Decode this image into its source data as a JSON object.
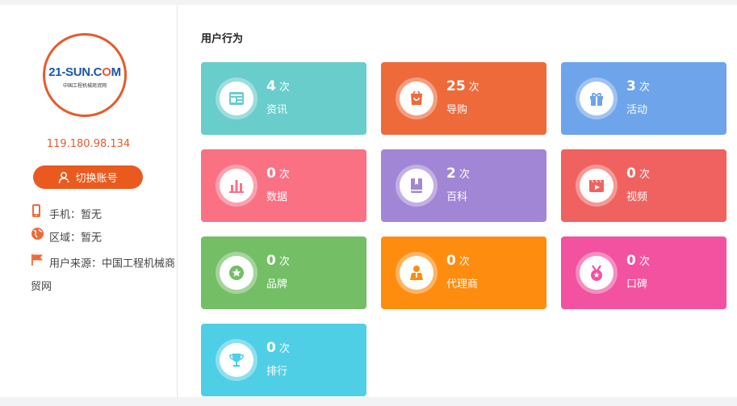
{
  "profile": {
    "logo_main_part1": "21-SUN.C",
    "logo_main_o": "O",
    "logo_main_part2": "M",
    "logo_sub": "中国工程机械商贸网",
    "ip": "119.180.98.134",
    "switch_label": "切换账号",
    "phone": "手机：暂无",
    "region": "区域：暂无",
    "source": "用户来源：中国工程机械商贸网"
  },
  "behavior": {
    "title": "用户行为",
    "unit": "次",
    "cards": [
      {
        "count": "4",
        "label": "资讯",
        "icon": "news-icon",
        "color": "#68cdcb"
      },
      {
        "count": "25",
        "label": "导购",
        "icon": "shopping-bag-icon",
        "color": "#ee6a3a"
      },
      {
        "count": "3",
        "label": "活动",
        "icon": "gift-icon",
        "color": "#6ea4ea"
      },
      {
        "count": "0",
        "label": "数据",
        "icon": "bar-chart-icon",
        "color": "#fb7184"
      },
      {
        "count": "2",
        "label": "百科",
        "icon": "book-icon",
        "color": "#a286d6"
      },
      {
        "count": "0",
        "label": "视频",
        "icon": "video-icon",
        "color": "#f0625f"
      },
      {
        "count": "0",
        "label": "品牌",
        "icon": "star-badge-icon",
        "color": "#74be66"
      },
      {
        "count": "0",
        "label": "代理商",
        "icon": "agent-icon",
        "color": "#fd8c0f"
      },
      {
        "count": "0",
        "label": "口碑",
        "icon": "medal-icon",
        "color": "#f2529f"
      },
      {
        "count": "0",
        "label": "排行",
        "icon": "trophy-icon",
        "color": "#4fcfe6"
      }
    ]
  }
}
